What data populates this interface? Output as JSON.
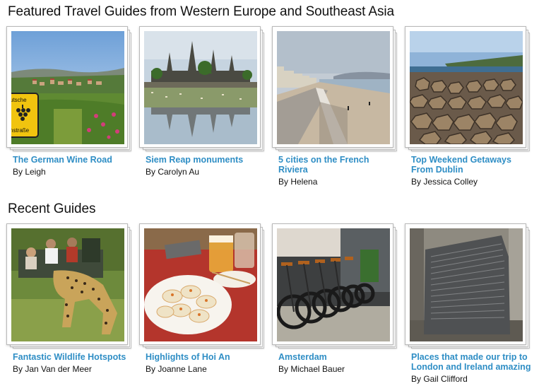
{
  "featured": {
    "heading": "Featured Travel Guides from Western Europe and Southeast Asia",
    "guides": [
      {
        "title": "The German Wine Road",
        "author": "By Leigh",
        "image": "german-wine-road-photo",
        "sign_line1": "utsche",
        "sign_line2": "nstraße"
      },
      {
        "title": "Siem Reap monuments",
        "author": "By Carolyn Au",
        "image": "angkor-wat-photo"
      },
      {
        "title": "5 cities on the French Riviera",
        "author": "By Helena",
        "image": "riviera-promenade-photo"
      },
      {
        "title": "Top Weekend Getaways From Dublin",
        "author": "By Jessica Colley",
        "image": "giants-causeway-photo"
      }
    ]
  },
  "recent": {
    "heading": "Recent Guides",
    "guides": [
      {
        "title": "Fantastic Wildlife Hotspots",
        "author": "By Jan Van der Meer",
        "image": "leopard-safari-photo"
      },
      {
        "title": "Highlights of Hoi An",
        "author": "By Joanne Lane",
        "image": "hoi-an-food-photo"
      },
      {
        "title": "Amsterdam",
        "author": "By Michael Bauer",
        "image": "amsterdam-bicycles-photo"
      },
      {
        "title": "Places that made our trip to London and Ireland amazing",
        "author": "By Gail Clifford",
        "image": "rosetta-stone-photo"
      }
    ]
  },
  "colors": {
    "link": "#2f8ec5",
    "text": "#111111",
    "frame_border": "#b9b9b9"
  }
}
